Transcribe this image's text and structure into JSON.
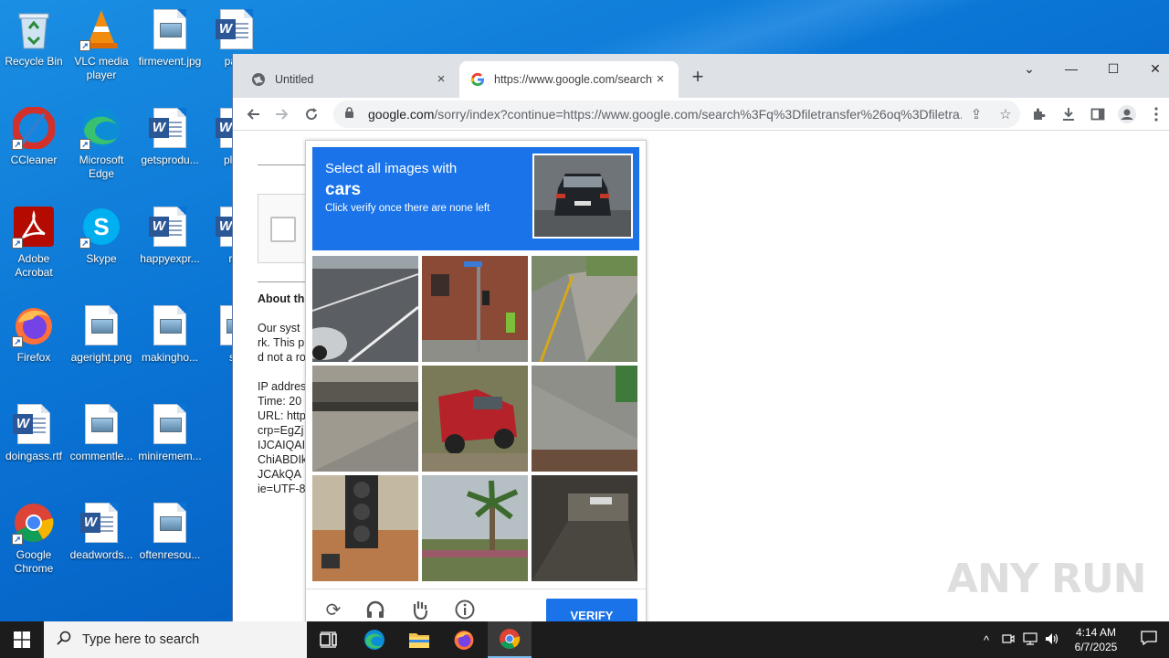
{
  "desktop": {
    "icons": [
      {
        "name": "Recycle Bin"
      },
      {
        "name": "VLC media player"
      },
      {
        "name": "firmevent.jpg"
      },
      {
        "name": "pape"
      },
      {
        "name": "CCleaner"
      },
      {
        "name": "Microsoft Edge"
      },
      {
        "name": "getsprodu..."
      },
      {
        "name": "playv"
      },
      {
        "name": "Adobe Acrobat"
      },
      {
        "name": "Skype"
      },
      {
        "name": "happyexpr..."
      },
      {
        "name": "rap"
      },
      {
        "name": "Firefox"
      },
      {
        "name": "ageright.png"
      },
      {
        "name": "makingho..."
      },
      {
        "name": "stb"
      },
      {
        "name": "doingass.rtf"
      },
      {
        "name": "commentle..."
      },
      {
        "name": "miniremem..."
      },
      {
        "name": "Google Chrome"
      },
      {
        "name": "deadwords..."
      },
      {
        "name": "oftenresou..."
      }
    ]
  },
  "browser": {
    "tabs": [
      {
        "title": "Untitled",
        "close": "×"
      },
      {
        "title": "https://www.google.com/search?q=",
        "close": "×"
      }
    ],
    "new_tab": "+",
    "window_controls": {
      "dropdown": "⌄",
      "minimize": "—",
      "maximize": "☐",
      "close": "✕"
    },
    "url_host": "google.com",
    "url_rest": "/sorry/index?continue=https://www.google.com/search%3Fq%3Dfiletransfer%26oq%3Dfiletra..."
  },
  "page": {
    "about_heading": "About th",
    "body_lines": [
      "Our syst",
      "rk. This p",
      "d not a ro"
    ],
    "info_lines": [
      "IP addres",
      "Time: 20",
      "URL: http",
      "crp=EgZj",
      "IJCAIQAI",
      "ChiABDIk",
      "JCAkQA",
      "ie=UTF-8"
    ]
  },
  "captcha": {
    "line1": "Select all images with",
    "target": "cars",
    "line3": "Click verify once there are none left",
    "verify_label": "VERIFY"
  },
  "watermark": "ANY RUN",
  "taskbar": {
    "search_placeholder": "Type here to search",
    "time": "4:14 AM",
    "date": "6/7/2025"
  },
  "colors": {
    "captcha_blue": "#1a73e8",
    "desktop_blue": "#0a73d4",
    "taskbar": "#1c1c1c"
  }
}
